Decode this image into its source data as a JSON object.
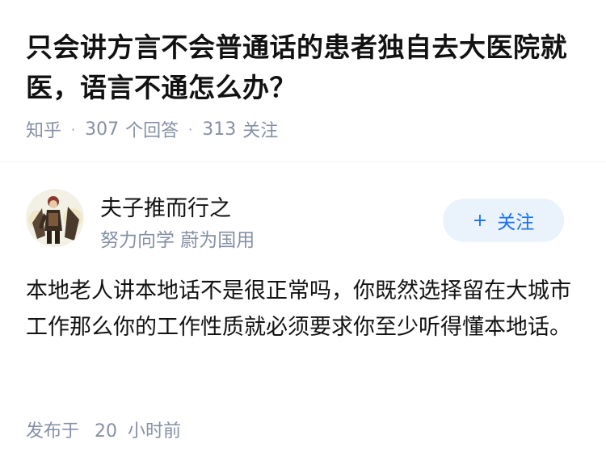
{
  "question": {
    "title": "只会讲方言不会普通话的患者独自去大医院就医，语言不通怎么办？",
    "source": "知乎",
    "answer_count": "307",
    "answer_label": "个回答",
    "follower_count": "313",
    "follower_label": "关注"
  },
  "author": {
    "name": "夫子推而行之",
    "bio": "努力向学 蔚为国用",
    "avatar_icon": "avatar-icon",
    "follow_label": "关注"
  },
  "answer": {
    "text": "本地老人讲本地话不是很正常吗，你既然选择留在大城市工作那么你的工作性质就必须要求你至少听得懂本地话。"
  },
  "footer": {
    "published_label": "发布于",
    "time_value": "20",
    "time_unit": "小时前"
  },
  "colors": {
    "title": "#121212",
    "meta": "#8590a6",
    "accent": "#1772f6",
    "button_bg": "#eaf2fb"
  }
}
